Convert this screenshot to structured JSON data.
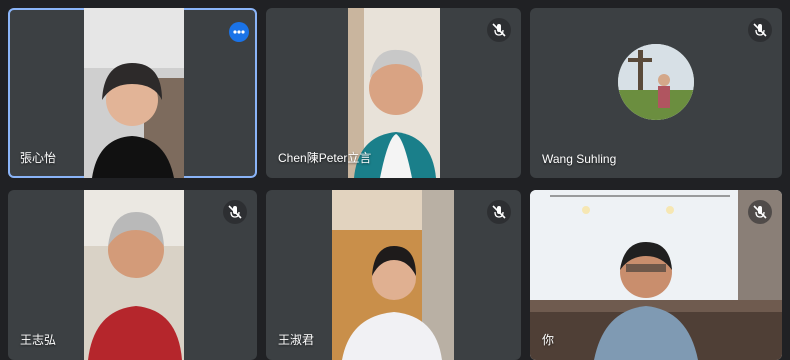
{
  "participants": [
    {
      "name": "張心怡",
      "muted": false,
      "video_on": true,
      "active_speaker": true
    },
    {
      "name": "Chen陳Peter立言",
      "muted": true,
      "video_on": true,
      "active_speaker": false
    },
    {
      "name": "Wang Suhling",
      "muted": true,
      "video_on": false,
      "active_speaker": false
    },
    {
      "name": "王志弘",
      "muted": true,
      "video_on": true,
      "active_speaker": false
    },
    {
      "name": "王淑君",
      "muted": true,
      "video_on": true,
      "active_speaker": false
    },
    {
      "name": "你",
      "muted": true,
      "video_on": true,
      "active_speaker": false
    }
  ],
  "icons": {
    "mute": "mic-off-icon",
    "more": "more-options-icon"
  },
  "colors": {
    "background": "#202124",
    "tile": "#3c4043",
    "active_border": "#8ab4f8",
    "more_button": "#1a73e8"
  }
}
